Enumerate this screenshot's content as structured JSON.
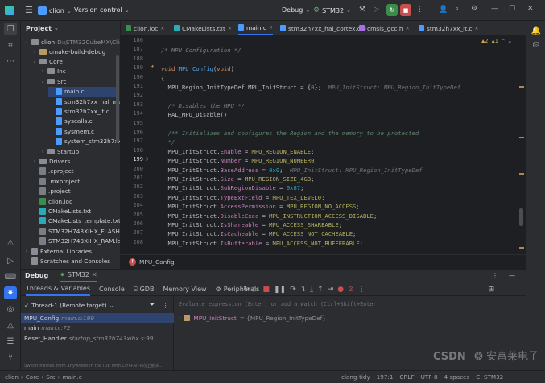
{
  "titlebar": {
    "project": "clion",
    "vcs": "Version control",
    "run_config": "Debug",
    "target": "STM32"
  },
  "project_panel": {
    "title": "Project",
    "root": "clion",
    "root_path": "D:\\STM32CubeMX\\Clion",
    "items": [
      {
        "label": "cmake-build-debug",
        "depth": 1,
        "arrow": "›",
        "kind": "folder-hi"
      },
      {
        "label": "Core",
        "depth": 1,
        "arrow": "⌄",
        "kind": "folder"
      },
      {
        "label": "Inc",
        "depth": 2,
        "arrow": "›",
        "kind": "folder"
      },
      {
        "label": "Src",
        "depth": 2,
        "arrow": "⌄",
        "kind": "folder"
      },
      {
        "label": "main.c",
        "depth": 3,
        "arrow": "",
        "kind": "c",
        "selected": true
      },
      {
        "label": "stm32h7xx_hal_msp.c",
        "depth": 3,
        "arrow": "",
        "kind": "c"
      },
      {
        "label": "stm32h7xx_it.c",
        "depth": 3,
        "arrow": "",
        "kind": "c"
      },
      {
        "label": "syscalls.c",
        "depth": 3,
        "arrow": "",
        "kind": "c"
      },
      {
        "label": "sysmem.c",
        "depth": 3,
        "arrow": "",
        "kind": "c"
      },
      {
        "label": "system_stm32h7xx.c",
        "depth": 3,
        "arrow": "",
        "kind": "c"
      },
      {
        "label": "Startup",
        "depth": 2,
        "arrow": "›",
        "kind": "folder"
      },
      {
        "label": "Drivers",
        "depth": 1,
        "arrow": "›",
        "kind": "folder"
      },
      {
        "label": ".cproject",
        "depth": 1,
        "arrow": "",
        "kind": "file"
      },
      {
        "label": ".mxproject",
        "depth": 1,
        "arrow": "",
        "kind": "file"
      },
      {
        "label": ".project",
        "depth": 1,
        "arrow": "",
        "kind": "file"
      },
      {
        "label": "clion.ioc",
        "depth": 1,
        "arrow": "",
        "kind": "ioc"
      },
      {
        "label": "CMakeLists.txt",
        "depth": 1,
        "arrow": "",
        "kind": "cmake"
      },
      {
        "label": "CMakeLists_template.txt",
        "depth": 1,
        "arrow": "",
        "kind": "cmake"
      },
      {
        "label": "STM32H743XIHX_FLASH.ld",
        "depth": 1,
        "arrow": "",
        "kind": "ld"
      },
      {
        "label": "STM32H743XIHX_RAM.ld",
        "depth": 1,
        "arrow": "",
        "kind": "ld"
      },
      {
        "label": "External Libraries",
        "depth": 0,
        "arrow": "›",
        "kind": "lib"
      },
      {
        "label": "Scratches and Consoles",
        "depth": 0,
        "arrow": "",
        "kind": "lib"
      }
    ]
  },
  "tabs": [
    {
      "label": "clion.ioc",
      "kind": "ioc"
    },
    {
      "label": "CMakeLists.txt",
      "kind": "cmake"
    },
    {
      "label": "main.c",
      "kind": "c",
      "active": true
    },
    {
      "label": "stm32h7xx_hal_cortex.c",
      "kind": "c"
    },
    {
      "label": "cmsis_gcc.h",
      "kind": "h"
    },
    {
      "label": "stm32h7xx_it.c",
      "kind": "c"
    }
  ],
  "editor": {
    "inspections": {
      "warnings": "▲2",
      "weak": "▲1"
    },
    "line_numbers": [
      "186",
      "187",
      "188",
      "189",
      "190",
      "191",
      "192",
      "193",
      "194",
      "195",
      "196",
      "197",
      "198",
      "199",
      "200",
      "201",
      "202",
      "203",
      "204",
      "205",
      "206",
      "207",
      "208"
    ],
    "current_line": "199",
    "breadcrumb": "MPU_Config",
    "lines": [
      [],
      [
        {
          "t": "/* MPU Configuration */",
          "c": "cm"
        }
      ],
      [],
      [
        {
          "t": "void ",
          "c": "kw"
        },
        {
          "t": "MPU_Config",
          "c": "fn"
        },
        {
          "t": "(",
          "c": ""
        },
        {
          "t": "void",
          "c": "kw"
        },
        {
          "t": ")",
          "c": ""
        }
      ],
      [
        {
          "t": "{",
          "c": ""
        }
      ],
      [
        {
          "t": "  MPU_Region_InitTypeDef MPU_InitStruct = {",
          "c": ""
        },
        {
          "t": "0",
          "c": "num"
        },
        {
          "t": "};  ",
          "c": ""
        },
        {
          "t": "MPU_InitStruct: MPU_Region_InitTypeDef",
          "c": "hint"
        }
      ],
      [],
      [
        {
          "t": "  /* Disables the MPU */",
          "c": "cm"
        }
      ],
      [
        {
          "t": "  HAL_MPU_Disable();",
          "c": ""
        }
      ],
      [],
      [
        {
          "t": "  /** Initializes and configures the Region and the memory to be protected",
          "c": "cm2"
        }
      ],
      [
        {
          "t": "  */",
          "c": "cm2"
        }
      ],
      [
        {
          "t": "  MPU_InitStruct.",
          "c": ""
        },
        {
          "t": "Enable",
          "c": "fld"
        },
        {
          "t": " = ",
          "c": ""
        },
        {
          "t": "MPU_REGION_ENABLE",
          "c": "mc"
        },
        {
          "t": ";",
          "c": ""
        }
      ],
      [
        {
          "t": "  MPU_InitStruct.",
          "c": ""
        },
        {
          "t": "Number",
          "c": "fld"
        },
        {
          "t": " = ",
          "c": ""
        },
        {
          "t": "MPU_REGION_NUMBER0",
          "c": "mc"
        },
        {
          "t": ";",
          "c": ""
        }
      ],
      [
        {
          "t": "  MPU_InitStruct.",
          "c": ""
        },
        {
          "t": "BaseAddress",
          "c": "fld"
        },
        {
          "t": " = ",
          "c": ""
        },
        {
          "t": "0x0",
          "c": "num"
        },
        {
          "t": ";  ",
          "c": ""
        },
        {
          "t": "MPU_InitStruct: MPU_Region_InitTypeDef",
          "c": "hint"
        }
      ],
      [
        {
          "t": "  MPU_InitStruct.",
          "c": ""
        },
        {
          "t": "Size",
          "c": "fld"
        },
        {
          "t": " = ",
          "c": ""
        },
        {
          "t": "MPU_REGION_SIZE_4GB",
          "c": "mc"
        },
        {
          "t": ";",
          "c": ""
        }
      ],
      [
        {
          "t": "  MPU_InitStruct.",
          "c": ""
        },
        {
          "t": "SubRegionDisable",
          "c": "fld"
        },
        {
          "t": " = ",
          "c": ""
        },
        {
          "t": "0x87",
          "c": "num"
        },
        {
          "t": ";",
          "c": ""
        }
      ],
      [
        {
          "t": "  MPU_InitStruct.",
          "c": ""
        },
        {
          "t": "TypeExtField",
          "c": "fld"
        },
        {
          "t": " = ",
          "c": ""
        },
        {
          "t": "MPU_TEX_LEVEL0",
          "c": "mc"
        },
        {
          "t": ";",
          "c": ""
        }
      ],
      [
        {
          "t": "  MPU_InitStruct.",
          "c": ""
        },
        {
          "t": "AccessPermission",
          "c": "fld"
        },
        {
          "t": " = ",
          "c": ""
        },
        {
          "t": "MPU_REGION_NO_ACCESS",
          "c": "mc"
        },
        {
          "t": ";",
          "c": ""
        }
      ],
      [
        {
          "t": "  MPU_InitStruct.",
          "c": ""
        },
        {
          "t": "DisableExec",
          "c": "fld"
        },
        {
          "t": " = ",
          "c": ""
        },
        {
          "t": "MPU_INSTRUCTION_ACCESS_DISABLE",
          "c": "mc"
        },
        {
          "t": ";",
          "c": ""
        }
      ],
      [
        {
          "t": "  MPU_InitStruct.",
          "c": ""
        },
        {
          "t": "IsShareable",
          "c": "fld"
        },
        {
          "t": " = ",
          "c": ""
        },
        {
          "t": "MPU_ACCESS_SHAREABLE",
          "c": "mc"
        },
        {
          "t": ";",
          "c": ""
        }
      ],
      [
        {
          "t": "  MPU_InitStruct.",
          "c": ""
        },
        {
          "t": "IsCacheable",
          "c": "fld"
        },
        {
          "t": " = ",
          "c": ""
        },
        {
          "t": "MPU_ACCESS_NOT_CACHEABLE",
          "c": "mc"
        },
        {
          "t": ";",
          "c": ""
        }
      ],
      [
        {
          "t": "  MPU_InitStruct.",
          "c": ""
        },
        {
          "t": "IsBufferable",
          "c": "fld"
        },
        {
          "t": " = ",
          "c": ""
        },
        {
          "t": "MPU_ACCESS_NOT_BUFFERABLE",
          "c": "mc"
        },
        {
          "t": ";",
          "c": ""
        }
      ]
    ]
  },
  "debug": {
    "title": "Debug",
    "session": "STM32",
    "tabs": [
      "Threads & Variables",
      "Console",
      "GDB",
      "Memory View",
      "Peripherals"
    ],
    "thread": "Thread-1 (Remote target)",
    "frames": [
      {
        "name": "MPU_Config",
        "loc": "main.c:199",
        "selected": true
      },
      {
        "name": "main",
        "loc": "main.c:72"
      },
      {
        "name": "Reset_Handler",
        "loc": "startup_stm32h743xihx.s:99"
      }
    ],
    "eval_placeholder": "Evaluate expression (Enter) or add a watch (Ctrl+Shift+Enter)",
    "variable": {
      "name": "MPU_InitStruct",
      "value": "= {MPU_Region_InitTypeDef}"
    },
    "hint": "Switch frames from anywhere in the IDE with Ctrl+Alt+向上箭头…"
  },
  "status": {
    "path": [
      "clion",
      "Core",
      "Src",
      "main.c"
    ],
    "linter": "clang-tidy",
    "position": "197:1",
    "line_sep": "CRLF",
    "encoding": "UTF-8",
    "indent": "4 spaces",
    "context": "C: STM32"
  },
  "watermark": {
    "left": "CSDN",
    "right": "安富莱电子"
  }
}
